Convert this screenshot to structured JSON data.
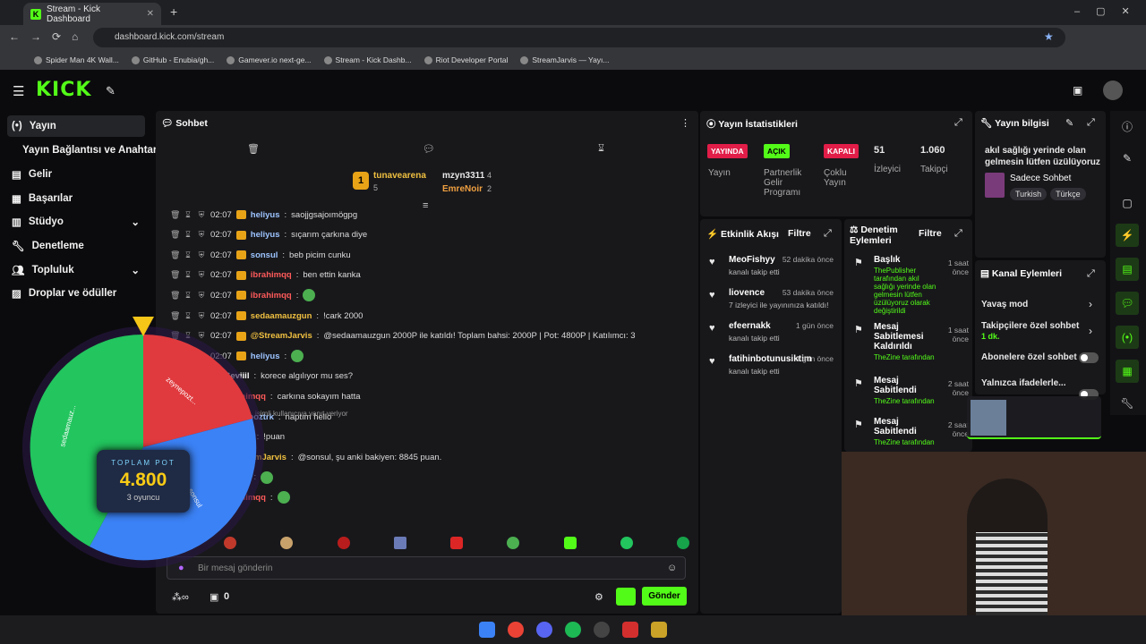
{
  "browser": {
    "tab_title": "Stream - Kick Dashboard",
    "url": "dashboard.kick.com/stream",
    "bookmarks": [
      "Spider Man 4K Wall...",
      "GitHub - Enubia/gh...",
      "Gamever.io next-ge...",
      "Stream - Kick Dashb...",
      "Riot Developer Portal",
      "StreamJarvis — Yayı..."
    ]
  },
  "sidebar": {
    "items": [
      {
        "label": "Yayın"
      },
      {
        "label": "Yayın Bağlantısı ve Anahtarı"
      },
      {
        "label": "Gelir"
      },
      {
        "label": "Başarılar"
      },
      {
        "label": "Stüdyo"
      },
      {
        "label": "Denetleme"
      },
      {
        "label": "Topluluk"
      },
      {
        "label": "Droplar ve ödüller"
      }
    ]
  },
  "chat": {
    "title": "Sohbet",
    "top": [
      {
        "rank": "1",
        "name": "tunavearena",
        "score": "5"
      },
      {
        "name": "mzyn3311",
        "score": "4"
      },
      {
        "name": "EmreNoir",
        "score": "2"
      }
    ],
    "messages": [
      {
        "time": "02:07",
        "user": "heliyus",
        "text": "saojjgsajoımögpg",
        "color": "#9dc4ff"
      },
      {
        "time": "02:07",
        "user": "heliyus",
        "text": "sıçarım çarkına diye",
        "color": "#9dc4ff"
      },
      {
        "time": "02:07",
        "user": "sonsul",
        "text": "beb picim cunku",
        "color": "#9dc4ff"
      },
      {
        "time": "02:07",
        "user": "ibrahimqq",
        "text": "ben ettin kanka",
        "color": "#ff5a5a"
      },
      {
        "time": "02:07",
        "user": "ibrahimqq",
        "text": "",
        "color": "#ff5a5a"
      },
      {
        "time": "02:07",
        "user": "sedaamauzgun",
        "text": "!cark 2000",
        "color": "#f0c040"
      },
      {
        "time": "02:07",
        "user": "@StreamJarvis",
        "text": "@sedaamauzgun 2000P ile katıldı! Toplam bahsi: 2000P | Pot: 4800P | Katılımcı: 3",
        "color": "#f0c040"
      },
      {
        "time": "02:07",
        "user": "heliyus",
        "text": "",
        "color": "#9dc4ff"
      },
      {
        "time": "",
        "user": "Seviiil",
        "text": "korece algılıyor mu ses?",
        "color": "#fff"
      },
      {
        "time": "",
        "user": "ibrahimqq",
        "text": "carkına sokayım hatta",
        "color": "#ff5a5a"
      },
      {
        "time": "",
        "user": "zeynepoztrk",
        "text": "naptım hello",
        "color": "#9dc4ff"
      },
      {
        "time": "",
        "user": "sonsul",
        "text": "!puan",
        "color": "#9dc4ff"
      },
      {
        "time": "",
        "user": "@StreamJarvis",
        "text": "@sonsul, şu anki bakiyen: 8845 puan.",
        "color": "#f0c040"
      },
      {
        "time": "",
        "user": "Seviiil",
        "text": "",
        "color": "#fff"
      },
      {
        "time": "",
        "user": "ibrahimqq",
        "text": "",
        "color": "#ff5a5a"
      }
    ],
    "reply_hint": "isimli kullanıcıya yanıt veriyor",
    "input_placeholder": "Bir mesaj gönderin",
    "send": "Gönder",
    "points": "0"
  },
  "wheel": {
    "pot_label": "TOPLAM POT",
    "pot_value": "4.800",
    "players": "3 oyuncu",
    "segments": [
      "zeynepozt...",
      "sedaamauz...",
      "sonsul"
    ]
  },
  "stats": {
    "title": "Yayın İstatistikleri",
    "live": "YAYINDA",
    "live_lbl": "Yayın",
    "partner": "AÇIK",
    "partner_lbl": "Partnerlik Gelir Programı",
    "multi": "KAPALI",
    "multi_lbl": "Çoklu Yayın",
    "viewers": "51",
    "viewers_lbl": "İzleyici",
    "followers": "1.060",
    "followers_lbl": "Takipçi"
  },
  "info": {
    "title": "Yayın bilgisi",
    "stream_title": "akıl sağlığı yerinde olan gelmesin lütfen üzülüyoruz",
    "category": "Sadece Sohbet",
    "tags": [
      "Turkish",
      "Türkçe"
    ]
  },
  "activity": {
    "title": "Etkinlik Akışı",
    "filter": "Filtre",
    "items": [
      {
        "name": "MeoFishyy",
        "time": "52 dakika önce",
        "desc": "kanalı takip etti"
      },
      {
        "name": "liovence",
        "time": "53 dakika önce",
        "desc": "7 izleyici ile yayınınıza katıldı!"
      },
      {
        "name": "efeernakk",
        "time": "1 gün önce",
        "desc": "kanalı takip etti"
      },
      {
        "name": "fatihinbotunusiktim",
        "time": "1 gün önce",
        "desc": "kanalı takip etti"
      }
    ]
  },
  "moderation": {
    "title": "Denetim Eylemleri",
    "filter": "Filtre",
    "items": [
      {
        "name": "Başlık",
        "time": "1 saat önce",
        "desc": "ThePublisher tarafından akıl sağlığı yerinde olan gelmesin lütfen üzülüyoruz olarak değiştirildi"
      },
      {
        "name": "Mesaj Sabitlemesi Kaldırıldı",
        "time": "1 saat önce",
        "desc": "TheZine tarafından"
      },
      {
        "name": "Mesaj Sabitlendi",
        "time": "2 saat önce",
        "desc": "TheZine tarafından"
      },
      {
        "name": "Mesaj Sabitlendi",
        "time": "2 saat önce",
        "desc": "TheZine tarafından"
      }
    ]
  },
  "channel": {
    "title": "Kanal Eylemleri",
    "items": [
      "Yavaş mod",
      "Takipçilere özel sohbet",
      "Abonelere özel sohbet",
      "Yalnızca ifadelerle..."
    ],
    "follow_sub": "1 dk."
  }
}
